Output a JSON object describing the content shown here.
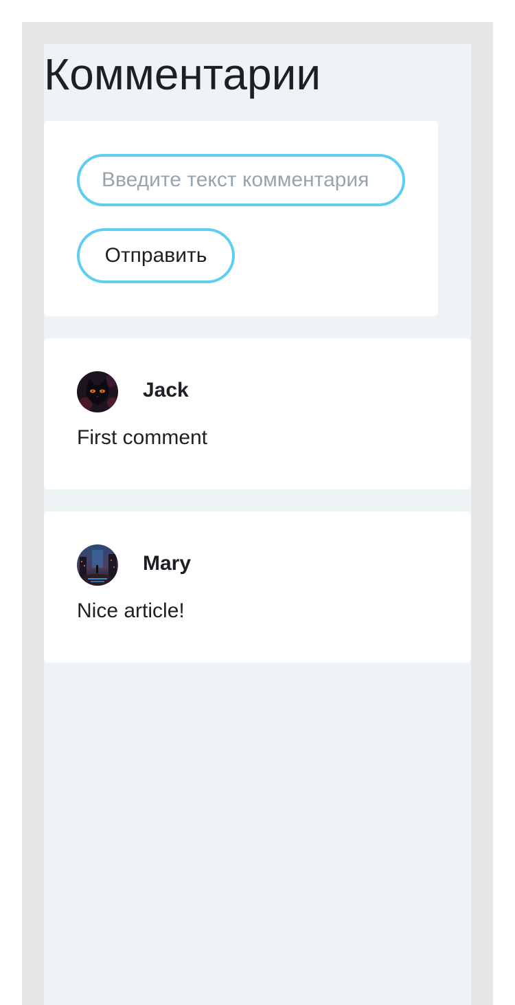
{
  "page": {
    "title": "Комментарии"
  },
  "form": {
    "input_placeholder": "Введите текст комментария",
    "input_value": "",
    "submit_label": "Отправить"
  },
  "comments": [
    {
      "author": "Jack",
      "text": "First comment",
      "avatar_icon": "black-cat-avatar"
    },
    {
      "author": "Mary",
      "text": "Nice article!",
      "avatar_icon": "night-city-avatar"
    }
  ],
  "colors": {
    "accent_border": "#5dcdf0",
    "page_background": "#eef3f6",
    "frame_background": "#e6e6e8",
    "card_background": "#ffffff",
    "text": "#1c2024",
    "placeholder": "#97a4ae"
  }
}
